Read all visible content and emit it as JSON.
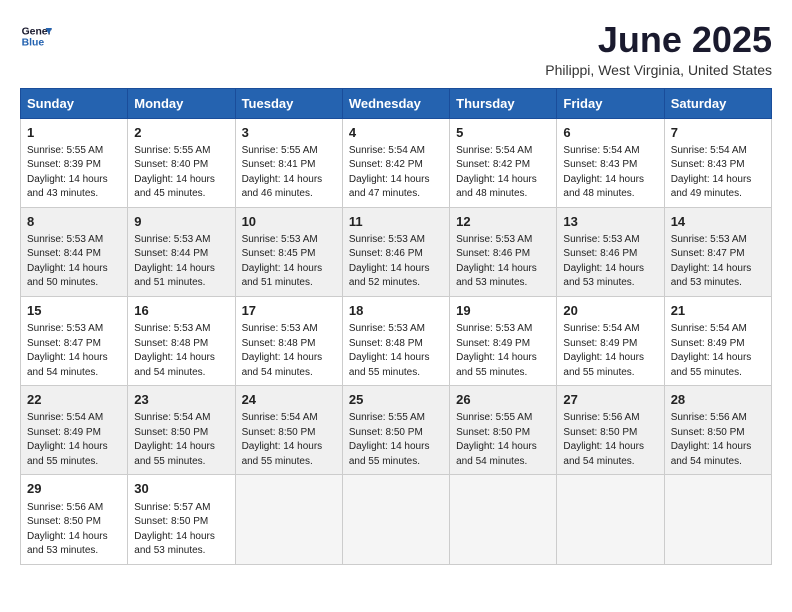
{
  "logo": {
    "general": "General",
    "blue": "Blue"
  },
  "title": "June 2025",
  "location": "Philippi, West Virginia, United States",
  "days_of_week": [
    "Sunday",
    "Monday",
    "Tuesday",
    "Wednesday",
    "Thursday",
    "Friday",
    "Saturday"
  ],
  "weeks": [
    [
      {
        "day": "1",
        "sunrise": "5:55 AM",
        "sunset": "8:39 PM",
        "daylight": "14 hours and 43 minutes."
      },
      {
        "day": "2",
        "sunrise": "5:55 AM",
        "sunset": "8:40 PM",
        "daylight": "14 hours and 45 minutes."
      },
      {
        "day": "3",
        "sunrise": "5:55 AM",
        "sunset": "8:41 PM",
        "daylight": "14 hours and 46 minutes."
      },
      {
        "day": "4",
        "sunrise": "5:54 AM",
        "sunset": "8:42 PM",
        "daylight": "14 hours and 47 minutes."
      },
      {
        "day": "5",
        "sunrise": "5:54 AM",
        "sunset": "8:42 PM",
        "daylight": "14 hours and 48 minutes."
      },
      {
        "day": "6",
        "sunrise": "5:54 AM",
        "sunset": "8:43 PM",
        "daylight": "14 hours and 48 minutes."
      },
      {
        "day": "7",
        "sunrise": "5:54 AM",
        "sunset": "8:43 PM",
        "daylight": "14 hours and 49 minutes."
      }
    ],
    [
      {
        "day": "8",
        "sunrise": "5:53 AM",
        "sunset": "8:44 PM",
        "daylight": "14 hours and 50 minutes."
      },
      {
        "day": "9",
        "sunrise": "5:53 AM",
        "sunset": "8:44 PM",
        "daylight": "14 hours and 51 minutes."
      },
      {
        "day": "10",
        "sunrise": "5:53 AM",
        "sunset": "8:45 PM",
        "daylight": "14 hours and 51 minutes."
      },
      {
        "day": "11",
        "sunrise": "5:53 AM",
        "sunset": "8:46 PM",
        "daylight": "14 hours and 52 minutes."
      },
      {
        "day": "12",
        "sunrise": "5:53 AM",
        "sunset": "8:46 PM",
        "daylight": "14 hours and 53 minutes."
      },
      {
        "day": "13",
        "sunrise": "5:53 AM",
        "sunset": "8:46 PM",
        "daylight": "14 hours and 53 minutes."
      },
      {
        "day": "14",
        "sunrise": "5:53 AM",
        "sunset": "8:47 PM",
        "daylight": "14 hours and 53 minutes."
      }
    ],
    [
      {
        "day": "15",
        "sunrise": "5:53 AM",
        "sunset": "8:47 PM",
        "daylight": "14 hours and 54 minutes."
      },
      {
        "day": "16",
        "sunrise": "5:53 AM",
        "sunset": "8:48 PM",
        "daylight": "14 hours and 54 minutes."
      },
      {
        "day": "17",
        "sunrise": "5:53 AM",
        "sunset": "8:48 PM",
        "daylight": "14 hours and 54 minutes."
      },
      {
        "day": "18",
        "sunrise": "5:53 AM",
        "sunset": "8:48 PM",
        "daylight": "14 hours and 55 minutes."
      },
      {
        "day": "19",
        "sunrise": "5:53 AM",
        "sunset": "8:49 PM",
        "daylight": "14 hours and 55 minutes."
      },
      {
        "day": "20",
        "sunrise": "5:54 AM",
        "sunset": "8:49 PM",
        "daylight": "14 hours and 55 minutes."
      },
      {
        "day": "21",
        "sunrise": "5:54 AM",
        "sunset": "8:49 PM",
        "daylight": "14 hours and 55 minutes."
      }
    ],
    [
      {
        "day": "22",
        "sunrise": "5:54 AM",
        "sunset": "8:49 PM",
        "daylight": "14 hours and 55 minutes."
      },
      {
        "day": "23",
        "sunrise": "5:54 AM",
        "sunset": "8:50 PM",
        "daylight": "14 hours and 55 minutes."
      },
      {
        "day": "24",
        "sunrise": "5:54 AM",
        "sunset": "8:50 PM",
        "daylight": "14 hours and 55 minutes."
      },
      {
        "day": "25",
        "sunrise": "5:55 AM",
        "sunset": "8:50 PM",
        "daylight": "14 hours and 55 minutes."
      },
      {
        "day": "26",
        "sunrise": "5:55 AM",
        "sunset": "8:50 PM",
        "daylight": "14 hours and 54 minutes."
      },
      {
        "day": "27",
        "sunrise": "5:56 AM",
        "sunset": "8:50 PM",
        "daylight": "14 hours and 54 minutes."
      },
      {
        "day": "28",
        "sunrise": "5:56 AM",
        "sunset": "8:50 PM",
        "daylight": "14 hours and 54 minutes."
      }
    ],
    [
      {
        "day": "29",
        "sunrise": "5:56 AM",
        "sunset": "8:50 PM",
        "daylight": "14 hours and 53 minutes."
      },
      {
        "day": "30",
        "sunrise": "5:57 AM",
        "sunset": "8:50 PM",
        "daylight": "14 hours and 53 minutes."
      },
      null,
      null,
      null,
      null,
      null
    ]
  ]
}
